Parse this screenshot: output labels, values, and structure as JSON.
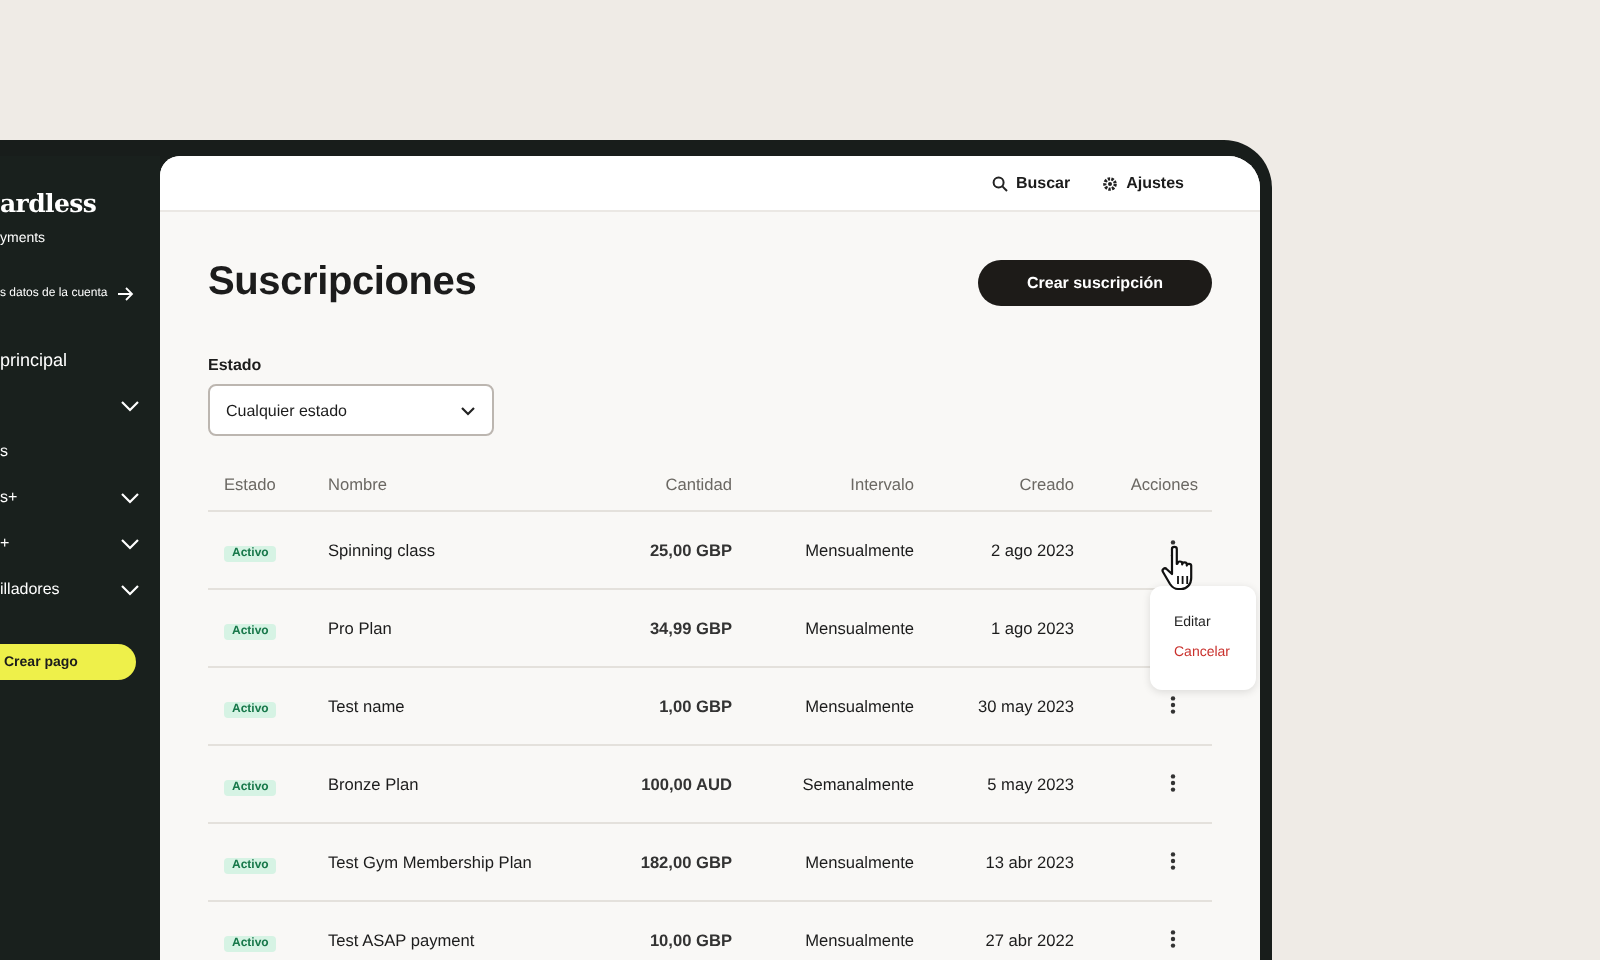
{
  "sidebar": {
    "logo": "ardless",
    "subtitle": "yments",
    "account_link": "s datos de la cuenta",
    "items": [
      {
        "label": "principal",
        "kind": "heading"
      },
      {
        "kind": "expandable",
        "expanded": false
      },
      {
        "label": "s",
        "kind": "plain"
      },
      {
        "label": "s+",
        "kind": "expandable",
        "expanded": false
      },
      {
        "label": "+",
        "kind": "expandable",
        "expanded": false
      },
      {
        "label": "illadores",
        "kind": "expandable",
        "expanded": false
      }
    ],
    "button": "Crear pago"
  },
  "top_bar": {
    "search": "Buscar",
    "settings": "Ajustes"
  },
  "page": {
    "title": "Suscripciones",
    "create_button": "Crear suscripción"
  },
  "filter": {
    "label": "Estado",
    "value": "Cualquier estado"
  },
  "table": {
    "columns": [
      "Estado",
      "Nombre",
      "Cantidad",
      "Intervalo",
      "Creado",
      "Acciones"
    ],
    "rows": [
      {
        "status": "Activo",
        "name": "Spinning class",
        "amount": "25,00 GBP",
        "interval": "Mensualmente",
        "created": "2 ago 2023"
      },
      {
        "status": "Activo",
        "name": "Pro Plan",
        "amount": "34,99 GBP",
        "interval": "Mensualmente",
        "created": "1 ago 2023"
      },
      {
        "status": "Activo",
        "name": "Test name",
        "amount": "1,00 GBP",
        "interval": "Mensualmente",
        "created": "30 may 2023"
      },
      {
        "status": "Activo",
        "name": "Bronze Plan",
        "amount": "100,00 AUD",
        "interval": "Semanalmente",
        "created": "5 may 2023"
      },
      {
        "status": "Activo",
        "name": "Test Gym Membership Plan",
        "amount": "182,00 GBP",
        "interval": "Mensualmente",
        "created": "13 abr 2023"
      },
      {
        "status": "Activo",
        "name": "Test ASAP payment",
        "amount": "10,00 GBP",
        "interval": "Mensualmente",
        "created": "27 abr 2022"
      }
    ]
  },
  "action_menu": {
    "items": [
      {
        "label": "Editar",
        "kind": "normal"
      },
      {
        "label": "Cancelar",
        "kind": "danger"
      }
    ]
  }
}
